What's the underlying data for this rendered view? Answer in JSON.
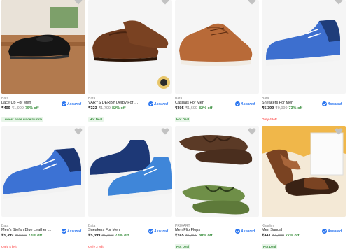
{
  "products": [
    {
      "brand": "Bata",
      "title": "Lace Up For Men",
      "price": "₹499",
      "mrp": "₹1,999",
      "off": "75% off",
      "tag": "Lowest price since launch",
      "tag_type": "deal",
      "assured": "Assured",
      "image": "black-derby-shoe",
      "heart": "heart-icon"
    },
    {
      "brand": "Bata",
      "title": "VARYS DERBY Derby For Men",
      "price": "₹323",
      "mrp": "₹1,799",
      "off": "82% off",
      "tag": "Hot Deal",
      "tag_type": "deal",
      "assured": "Assured",
      "image": "brown-derby-shoe",
      "heart": "heart-icon"
    },
    {
      "brand": "Bata",
      "title": "Casuals For Men",
      "price": "₹305",
      "mrp": "₹1,699",
      "off": "82% off",
      "tag": "Hot Deal",
      "tag_type": "deal",
      "assured": "Assured",
      "image": "tan-casual-shoe",
      "heart": "heart-icon"
    },
    {
      "brand": "Bata",
      "title": "Sneakers For Men",
      "price": "₹5,399",
      "mrp": "₹9,999",
      "off": "73% off",
      "tag": "Only 4 left",
      "tag_type": "left",
      "assured": "Assured",
      "image": "blue-sneaker",
      "heart": "heart-icon"
    },
    {
      "brand": "Bata",
      "title": "Men's Stefan Blue Leather Snee...",
      "price": "₹5,399",
      "mrp": "₹9,999",
      "off": "73% off",
      "tag": "Only 4 left",
      "tag_type": "left",
      "assured": "Assured",
      "image": "blue-sneaker-side",
      "heart": "heart-icon"
    },
    {
      "brand": "Bata",
      "title": "Sneakers For Men",
      "price": "₹5,399",
      "mrp": "₹9,999",
      "off": "73% off",
      "tag": "Only 2 left",
      "tag_type": "left",
      "assured": "Assured",
      "image": "blue-sneaker-pair",
      "heart": "heart-icon"
    },
    {
      "brand": "PRIXART",
      "title": "Men Flip Flops",
      "price": "₹245",
      "mrp": "₹1,999",
      "off": "80% off",
      "tag": "Hot Deal",
      "tag_type": "deal",
      "assured": "Assured",
      "image": "flip-flops",
      "heart": "heart-icon"
    },
    {
      "brand": "Khadim",
      "title": "Men Sandal",
      "price": "₹441",
      "mrp": "₹1,999",
      "off": "77% off",
      "tag": "Hot Deal",
      "tag_type": "deal",
      "assured": "Assured",
      "image": "brown-sandal",
      "heart": "heart-icon"
    }
  ],
  "colors": {
    "accent": "#2874f0",
    "discount": "#388e3c",
    "stock": "#ff6161"
  }
}
